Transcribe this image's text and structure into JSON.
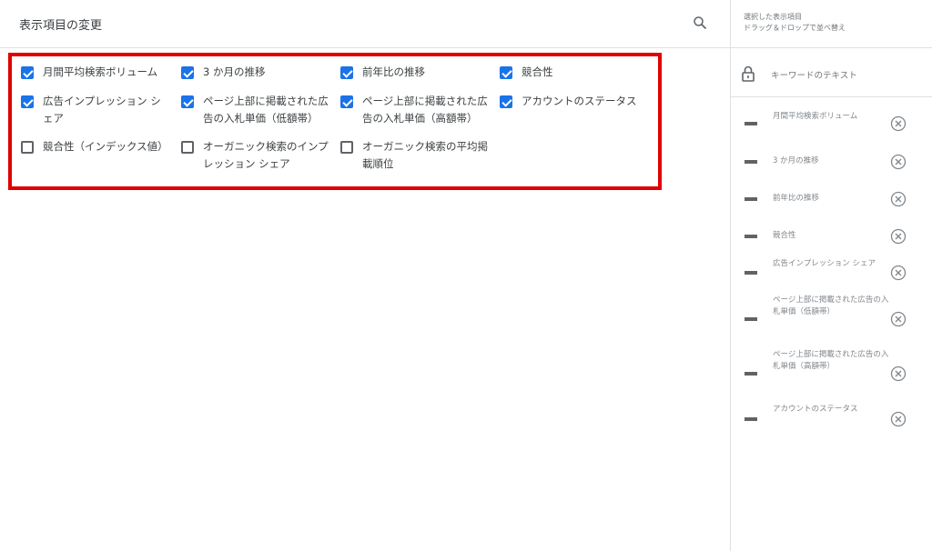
{
  "header": {
    "title": "表示項目の変更"
  },
  "options": [
    {
      "label": "月間平均検索ボリューム",
      "checked": true
    },
    {
      "label": "3 か月の推移",
      "checked": true
    },
    {
      "label": "前年比の推移",
      "checked": true
    },
    {
      "label": "競合性",
      "checked": true
    },
    {
      "label": "広告インプレッション シェア",
      "checked": true
    },
    {
      "label": "ページ上部に掲載された広告の入札単価（低額帯）",
      "checked": true
    },
    {
      "label": "ページ上部に掲載された広告の入札単価（高額帯）",
      "checked": true
    },
    {
      "label": "アカウントのステータス",
      "checked": true
    },
    {
      "label": "競合性（インデックス値）",
      "checked": false
    },
    {
      "label": "オーガニック検索のインプレッション シェア",
      "checked": false
    },
    {
      "label": "オーガニック検索の平均掲載順位",
      "checked": false
    }
  ],
  "sidebar": {
    "title_line1": "選択した表示項目",
    "title_line2": "ドラッグ＆ドロップで並べ替え",
    "keyword_label": "キーワードのテキスト",
    "items": [
      "月間平均検索ボリューム",
      "3 か月の推移",
      "前年比の推移",
      "競合性",
      "広告インプレッション シェア",
      "ページ上部に掲載された広告の入札単価（低額帯）",
      "ページ上部に掲載された広告の入札単価（高額帯）",
      "アカウントのステータス"
    ]
  },
  "colors": {
    "checkbox_checked": "#1a73e8",
    "highlight_border": "#e00000"
  },
  "icons": {
    "search": "search-icon",
    "lock": "lock-icon",
    "remove": "remove-circle-icon",
    "drag": "drag-handle-icon"
  }
}
